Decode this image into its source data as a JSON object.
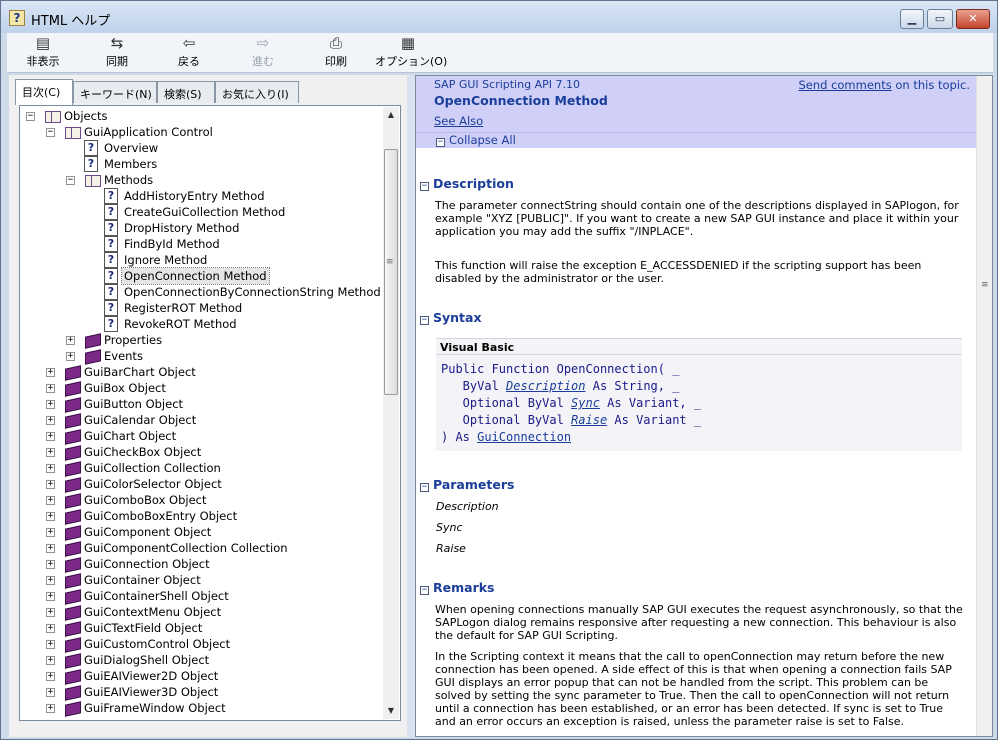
{
  "window": {
    "title": "HTML ヘルプ"
  },
  "toolbar": [
    {
      "label": "非表示",
      "icon": "hide-icon"
    },
    {
      "label": "同期",
      "icon": "sync-icon"
    },
    {
      "label": "戻る",
      "icon": "back-icon"
    },
    {
      "label": "進む",
      "icon": "forward-icon",
      "disabled": true
    },
    {
      "label": "印刷",
      "icon": "print-icon"
    },
    {
      "label": "オプション(O)",
      "icon": "options-icon"
    }
  ],
  "tabs": [
    "目次(C)",
    "キーワード(N)",
    "検索(S)",
    "お気に入り(I)"
  ],
  "tree": [
    {
      "label": "Objects",
      "indent": 0,
      "icon": "book-open",
      "expander": "-"
    },
    {
      "label": "GuiApplication Control",
      "indent": 1,
      "icon": "book-open",
      "expander": "-"
    },
    {
      "label": "Overview",
      "indent": 2,
      "icon": "help"
    },
    {
      "label": "Members",
      "indent": 2,
      "icon": "help"
    },
    {
      "label": "Methods",
      "indent": 2,
      "icon": "book-open",
      "expander": "-"
    },
    {
      "label": "AddHistoryEntry Method",
      "indent": 3,
      "icon": "help"
    },
    {
      "label": "CreateGuiCollection Method",
      "indent": 3,
      "icon": "help"
    },
    {
      "label": "DropHistory Method",
      "indent": 3,
      "icon": "help"
    },
    {
      "label": "FindById Method",
      "indent": 3,
      "icon": "help"
    },
    {
      "label": "Ignore Method",
      "indent": 3,
      "icon": "help"
    },
    {
      "label": "OpenConnection Method",
      "indent": 3,
      "icon": "help",
      "selected": true
    },
    {
      "label": "OpenConnectionByConnectionString Method",
      "indent": 3,
      "icon": "help"
    },
    {
      "label": "RegisterROT Method",
      "indent": 3,
      "icon": "help"
    },
    {
      "label": "RevokeROT Method",
      "indent": 3,
      "icon": "help"
    },
    {
      "label": "Properties",
      "indent": 2,
      "icon": "book",
      "expander": "+"
    },
    {
      "label": "Events",
      "indent": 2,
      "icon": "book",
      "expander": "+"
    },
    {
      "label": "GuiBarChart Object",
      "indent": 1,
      "icon": "book",
      "expander": "+"
    },
    {
      "label": "GuiBox Object",
      "indent": 1,
      "icon": "book",
      "expander": "+"
    },
    {
      "label": "GuiButton Object",
      "indent": 1,
      "icon": "book",
      "expander": "+"
    },
    {
      "label": "GuiCalendar Object",
      "indent": 1,
      "icon": "book",
      "expander": "+"
    },
    {
      "label": "GuiChart Object",
      "indent": 1,
      "icon": "book",
      "expander": "+"
    },
    {
      "label": "GuiCheckBox Object",
      "indent": 1,
      "icon": "book",
      "expander": "+"
    },
    {
      "label": "GuiCollection Collection",
      "indent": 1,
      "icon": "book",
      "expander": "+"
    },
    {
      "label": "GuiColorSelector Object",
      "indent": 1,
      "icon": "book",
      "expander": "+"
    },
    {
      "label": "GuiComboBox Object",
      "indent": 1,
      "icon": "book",
      "expander": "+"
    },
    {
      "label": "GuiComboBoxEntry Object",
      "indent": 1,
      "icon": "book",
      "expander": "+"
    },
    {
      "label": "GuiComponent Object",
      "indent": 1,
      "icon": "book",
      "expander": "+"
    },
    {
      "label": "GuiComponentCollection Collection",
      "indent": 1,
      "icon": "book",
      "expander": "+"
    },
    {
      "label": "GuiConnection Object",
      "indent": 1,
      "icon": "book",
      "expander": "+"
    },
    {
      "label": "GuiContainer Object",
      "indent": 1,
      "icon": "book",
      "expander": "+"
    },
    {
      "label": "GuiContainerShell Object",
      "indent": 1,
      "icon": "book",
      "expander": "+"
    },
    {
      "label": "GuiContextMenu Object",
      "indent": 1,
      "icon": "book",
      "expander": "+"
    },
    {
      "label": "GuiCTextField Object",
      "indent": 1,
      "icon": "book",
      "expander": "+"
    },
    {
      "label": "GuiCustomControl Object",
      "indent": 1,
      "icon": "book",
      "expander": "+"
    },
    {
      "label": "GuiDialogShell Object",
      "indent": 1,
      "icon": "book",
      "expander": "+"
    },
    {
      "label": "GuiEAIViewer2D Object",
      "indent": 1,
      "icon": "book",
      "expander": "+"
    },
    {
      "label": "GuiEAIViewer3D Object",
      "indent": 1,
      "icon": "book",
      "expander": "+"
    },
    {
      "label": "GuiFrameWindow Object",
      "indent": 1,
      "icon": "book",
      "expander": "+"
    }
  ],
  "topic": {
    "api_title": "SAP GUI Scripting API 7.10",
    "feedback_link": "Send comments",
    "feedback_suffix": " on this topic.",
    "title": "OpenConnection Method",
    "see_also": "See Also",
    "collapse_all": "Collapse All",
    "description_head": "Description",
    "description_p1": "The parameter connectString should contain one of the descriptions displayed in SAPlogon, for example \"XYZ [PUBLIC]\". If you want to create a new SAP GUI instance and place it within your application you may add the suffix \"/INPLACE\".",
    "description_p2": "This function will raise the exception E_ACCESSDENIED if the scripting support has been disabled by the administrator or the user.",
    "syntax_head": "Syntax",
    "code_lang": "Visual Basic",
    "code": {
      "l1": "Public Function OpenConnection( _",
      "l2a": "   ByVal ",
      "l2b": "Description",
      "l2c": " As String, _",
      "l3a": "   Optional ByVal ",
      "l3b": "Sync",
      "l3c": " As Variant, _",
      "l4a": "   Optional ByVal ",
      "l4b": "Raise",
      "l4c": " As Variant _",
      "l5a": ") As ",
      "l5b": "GuiConnection"
    },
    "parameters_head": "Parameters",
    "params": [
      "Description",
      "Sync",
      "Raise"
    ],
    "remarks_head": "Remarks",
    "remarks_p1": "When opening connections manually SAP GUI executes the request asynchronously, so that the SAPLogon dialog remains responsive after requesting a new connection. This behaviour is also the default for SAP GUI Scripting.",
    "remarks_p2": "In the Scripting context it means that the call to openConnection may return before the new connection has been opened. A side effect of this is that when opening a connection fails SAP GUI displays an error popup that can not be handled from the script. This problem can be solved by setting the sync parameter to True. Then the call to openConnection will not return until a connection has been established, or an error has been detected. If sync is set to True and an error occurs an exception is raised, unless the parameter raise is set to False."
  }
}
